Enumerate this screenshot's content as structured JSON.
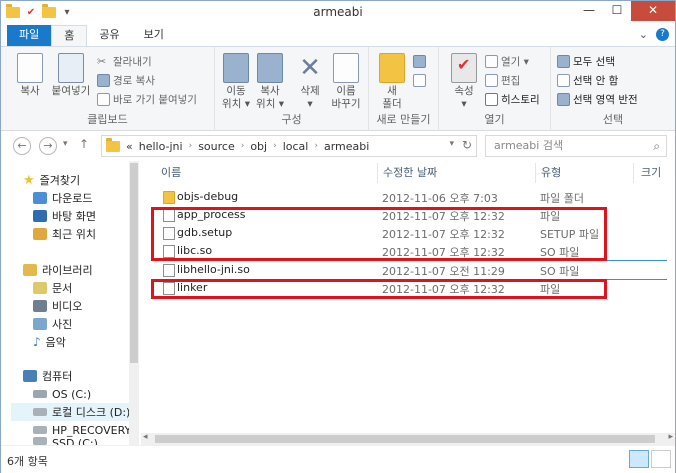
{
  "window": {
    "title": "armeabi"
  },
  "tabs": [
    {
      "label": "파일"
    },
    {
      "label": "홈"
    },
    {
      "label": "공유"
    },
    {
      "label": "보기"
    }
  ],
  "ribbon": {
    "clipboard": {
      "copy": "복사",
      "paste": "붙여넣기",
      "cut": "잘라내기",
      "copy_path": "경로 복사",
      "paste_shortcut": "바로 가기 붙여넣기",
      "label": "클립보드"
    },
    "organize": {
      "move_to": [
        "이동",
        "위치 ▾"
      ],
      "copy_to": [
        "복사",
        "위치 ▾"
      ],
      "delete": [
        "삭제",
        "▾"
      ],
      "rename": [
        "이름",
        "바꾸기"
      ],
      "label": "구성"
    },
    "new": {
      "new_folder": [
        "새",
        "폴더"
      ],
      "label": "새로 만들기"
    },
    "open": {
      "properties": [
        "속성",
        "▾"
      ],
      "open": "열기 ▾",
      "edit": "편집",
      "history": "히스토리",
      "label": "열기"
    },
    "select": {
      "select_all": "모두 선택",
      "select_none": "선택 안 함",
      "invert": "선택 영역 반전",
      "label": "선택"
    }
  },
  "address": {
    "segments": [
      "«",
      "hello-jni",
      "source",
      "obj",
      "local",
      "armeabi"
    ],
    "search_placeholder": "armeabi 검색"
  },
  "navpane": {
    "items": [
      {
        "label": "즐겨찾기",
        "icon": "star-icon",
        "color": "#f2c12e"
      },
      {
        "label": "다운로드",
        "icon": "downloads-folder-icon",
        "color": "#4a8fd6"
      },
      {
        "label": "바탕 화면",
        "icon": "desktop-icon",
        "color": "#2f6db3"
      },
      {
        "label": "최근 위치",
        "icon": "recent-places-icon",
        "color": "#e0a83a"
      },
      {
        "label": "라이브러리",
        "icon": "library-icon",
        "color": "#e5b84b"
      },
      {
        "label": "문서",
        "icon": "documents-icon",
        "color": "#e0c96b"
      },
      {
        "label": "비디오",
        "icon": "videos-icon",
        "color": "#6f7f8f"
      },
      {
        "label": "사진",
        "icon": "pictures-icon",
        "color": "#7ba7cf"
      },
      {
        "label": "음악",
        "icon": "music-icon",
        "color": "#3a7fc6"
      },
      {
        "label": "컴퓨터",
        "icon": "computer-icon",
        "color": "#4b7fb8"
      },
      {
        "label": "OS (C:)",
        "icon": "drive-icon",
        "color": "#9aa6b2"
      },
      {
        "label": "로컬 디스크 (D:)",
        "icon": "drive-icon",
        "color": "#a8b0b8"
      },
      {
        "label": "HP_RECOVERY (I",
        "icon": "drive-icon",
        "color": "#a8b0b8"
      },
      {
        "label": "SSD (C:)",
        "icon": "drive-icon",
        "color": "#a8b0b8"
      }
    ]
  },
  "columns": {
    "name": "이름",
    "date": "수정한 날짜",
    "type": "유형",
    "size": "크기"
  },
  "files": [
    {
      "name": "objs-debug",
      "date": "2012-11-06 오후 7:03",
      "type": "파일 폴더",
      "kind": "folder"
    },
    {
      "name": "app_process",
      "date": "2012-11-07 오후 12:32",
      "type": "파일",
      "kind": "file"
    },
    {
      "name": "gdb.setup",
      "date": "2012-11-07 오후 12:32",
      "type": "SETUP 파일",
      "kind": "file"
    },
    {
      "name": "libc.so",
      "date": "2012-11-07 오후 12:32",
      "type": "SO 파일",
      "kind": "file"
    },
    {
      "name": "libhello-jni.so",
      "date": "2012-11-07 오전 11:29",
      "type": "SO 파일",
      "kind": "file"
    },
    {
      "name": "linker",
      "date": "2012-11-07 오후 12:32",
      "type": "파일",
      "kind": "file"
    }
  ],
  "status": {
    "count": "6개 항목"
  },
  "colors": {
    "accent": "#1979ca",
    "highlight": "#e0121c",
    "close": "#c74c3c"
  }
}
